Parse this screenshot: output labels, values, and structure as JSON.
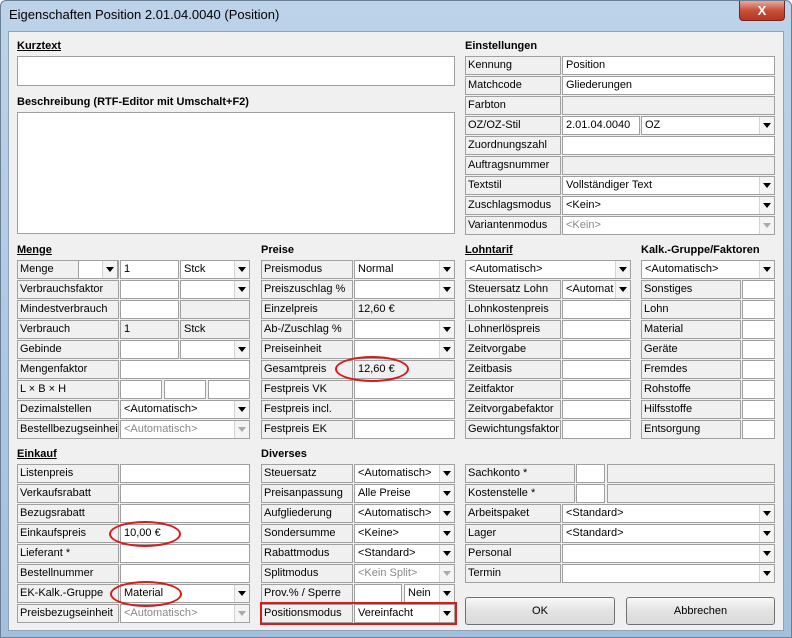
{
  "window": {
    "title": "Eigenschaften Position 2.01.04.0040 (Position)",
    "close_label": "X"
  },
  "kurztext": {
    "label": "Kurztext",
    "value": ""
  },
  "beschreibung": {
    "label": "Beschreibung (RTF-Editor mit Umschalt+F2)",
    "value": ""
  },
  "einstellungen": {
    "title": "Einstellungen",
    "rows": [
      {
        "label": "Kennung",
        "value": "Position"
      },
      {
        "label": "Matchcode",
        "value": "Gliederungen"
      },
      {
        "label": "Farbton",
        "value": ""
      },
      {
        "label": "OZ/OZ-Stil",
        "value": "2.01.04.0040",
        "value2": "OZ"
      },
      {
        "label": "Zuordnungszahl",
        "value": ""
      },
      {
        "label": "Auftragsnummer",
        "value": ""
      },
      {
        "label": "Textstil",
        "value": "Vollständiger Text"
      },
      {
        "label": "Zuschlagsmodus",
        "value": "<Kein>"
      },
      {
        "label": "Variantenmodus",
        "value": "<Kein>"
      }
    ]
  },
  "menge": {
    "title": "Menge",
    "rows": [
      {
        "label": "Menge",
        "v1": "",
        "v2": "1",
        "v3": "Stck"
      },
      {
        "label": "Verbrauchsfaktor",
        "v1": "",
        "v2": ""
      },
      {
        "label": "Mindestverbrauch",
        "v1": ""
      },
      {
        "label": "Verbrauch",
        "v1": "1",
        "v2": "Stck"
      },
      {
        "label": "Gebinde",
        "v1": "",
        "v2": ""
      },
      {
        "label": "Mengenfaktor",
        "v1": ""
      },
      {
        "label": "L × B × H",
        "v1": "",
        "v2": "",
        "v3": ""
      },
      {
        "label": "Dezimalstellen",
        "v1": "<Automatisch>"
      },
      {
        "label": "Bestellbezugseinheit",
        "v1": "<Automatisch>"
      }
    ]
  },
  "preise": {
    "title": "Preise",
    "rows": [
      {
        "label": "Preismodus",
        "value": "Normal"
      },
      {
        "label": "Preiszuschlag %",
        "value": ""
      },
      {
        "label": "Einzelpreis",
        "value": "12,60 €"
      },
      {
        "label": "Ab-/Zuschlag %",
        "value": ""
      },
      {
        "label": "Preiseinheit",
        "value": ""
      },
      {
        "label": "Gesamtpreis",
        "value": "12,60 €"
      },
      {
        "label": "Festpreis VK",
        "value": ""
      },
      {
        "label": "Festpreis incl.",
        "value": ""
      },
      {
        "label": "Festpreis EK",
        "value": ""
      }
    ]
  },
  "lohntarif": {
    "title": "Lohntarif",
    "top": "<Automatisch>",
    "rows": [
      {
        "label": "Steuersatz Lohn",
        "value": "<Automat"
      },
      {
        "label": "Lohnkostenpreis",
        "value": ""
      },
      {
        "label": "Lohnerlöspreis",
        "value": ""
      },
      {
        "label": "Zeitvorgabe",
        "value": ""
      },
      {
        "label": "Zeitbasis",
        "value": ""
      },
      {
        "label": "Zeitfaktor",
        "value": ""
      },
      {
        "label": "Zeitvorgabefaktor",
        "value": ""
      },
      {
        "label": "Gewichtungsfaktor",
        "value": ""
      }
    ]
  },
  "kalk": {
    "title": "Kalk.-Gruppe/Faktoren",
    "top": "<Automatisch>",
    "rows": [
      {
        "label": "Sonstiges",
        "value": ""
      },
      {
        "label": "Lohn",
        "value": ""
      },
      {
        "label": "Material",
        "value": ""
      },
      {
        "label": "Geräte",
        "value": ""
      },
      {
        "label": "Fremdes",
        "value": ""
      },
      {
        "label": "Rohstoffe",
        "value": ""
      },
      {
        "label": "Hilfsstoffe",
        "value": ""
      },
      {
        "label": "Entsorgung",
        "value": ""
      }
    ]
  },
  "einkauf": {
    "title": "Einkauf",
    "rows": [
      {
        "label": "Listenpreis",
        "value": ""
      },
      {
        "label": "Verkaufsrabatt",
        "value": ""
      },
      {
        "label": "Bezugsrabatt",
        "value": ""
      },
      {
        "label": "Einkaufspreis",
        "value": "10,00 €"
      },
      {
        "label": "Lieferant *",
        "value": ""
      },
      {
        "label": "Bestellnummer",
        "value": ""
      },
      {
        "label": "EK-Kalk.-Gruppe",
        "value": "Material"
      },
      {
        "label": "Preisbezugseinheit",
        "value": "<Automatisch>"
      }
    ]
  },
  "diverses": {
    "title": "Diverses",
    "rows": [
      {
        "label": "Steuersatz",
        "value": "<Automatisch>"
      },
      {
        "label": "Preisanpassung",
        "value": "Alle Preise"
      },
      {
        "label": "Aufgliederung",
        "value": "<Automatisch>"
      },
      {
        "label": "Sondersumme",
        "value": "<Keine>"
      },
      {
        "label": "Rabattmodus",
        "value": "<Standard>"
      },
      {
        "label": "Splitmodus",
        "value": "<Kein Split>"
      },
      {
        "label": "Prov.% / Sperre",
        "value": "",
        "value2": "Nein"
      },
      {
        "label": "Positionsmodus",
        "value": "Vereinfacht"
      }
    ]
  },
  "konten": {
    "rows": [
      {
        "label": "Sachkonto *",
        "v1": "",
        "v2": ""
      },
      {
        "label": "Kostenstelle *",
        "v1": "",
        "v2": ""
      },
      {
        "label": "Arbeitspaket",
        "value": "<Standard>"
      },
      {
        "label": "Lager",
        "value": "<Standard>"
      },
      {
        "label": "Personal",
        "value": ""
      },
      {
        "label": "Termin",
        "value": ""
      }
    ]
  },
  "buttons": {
    "ok": "OK",
    "cancel": "Abbrechen"
  }
}
